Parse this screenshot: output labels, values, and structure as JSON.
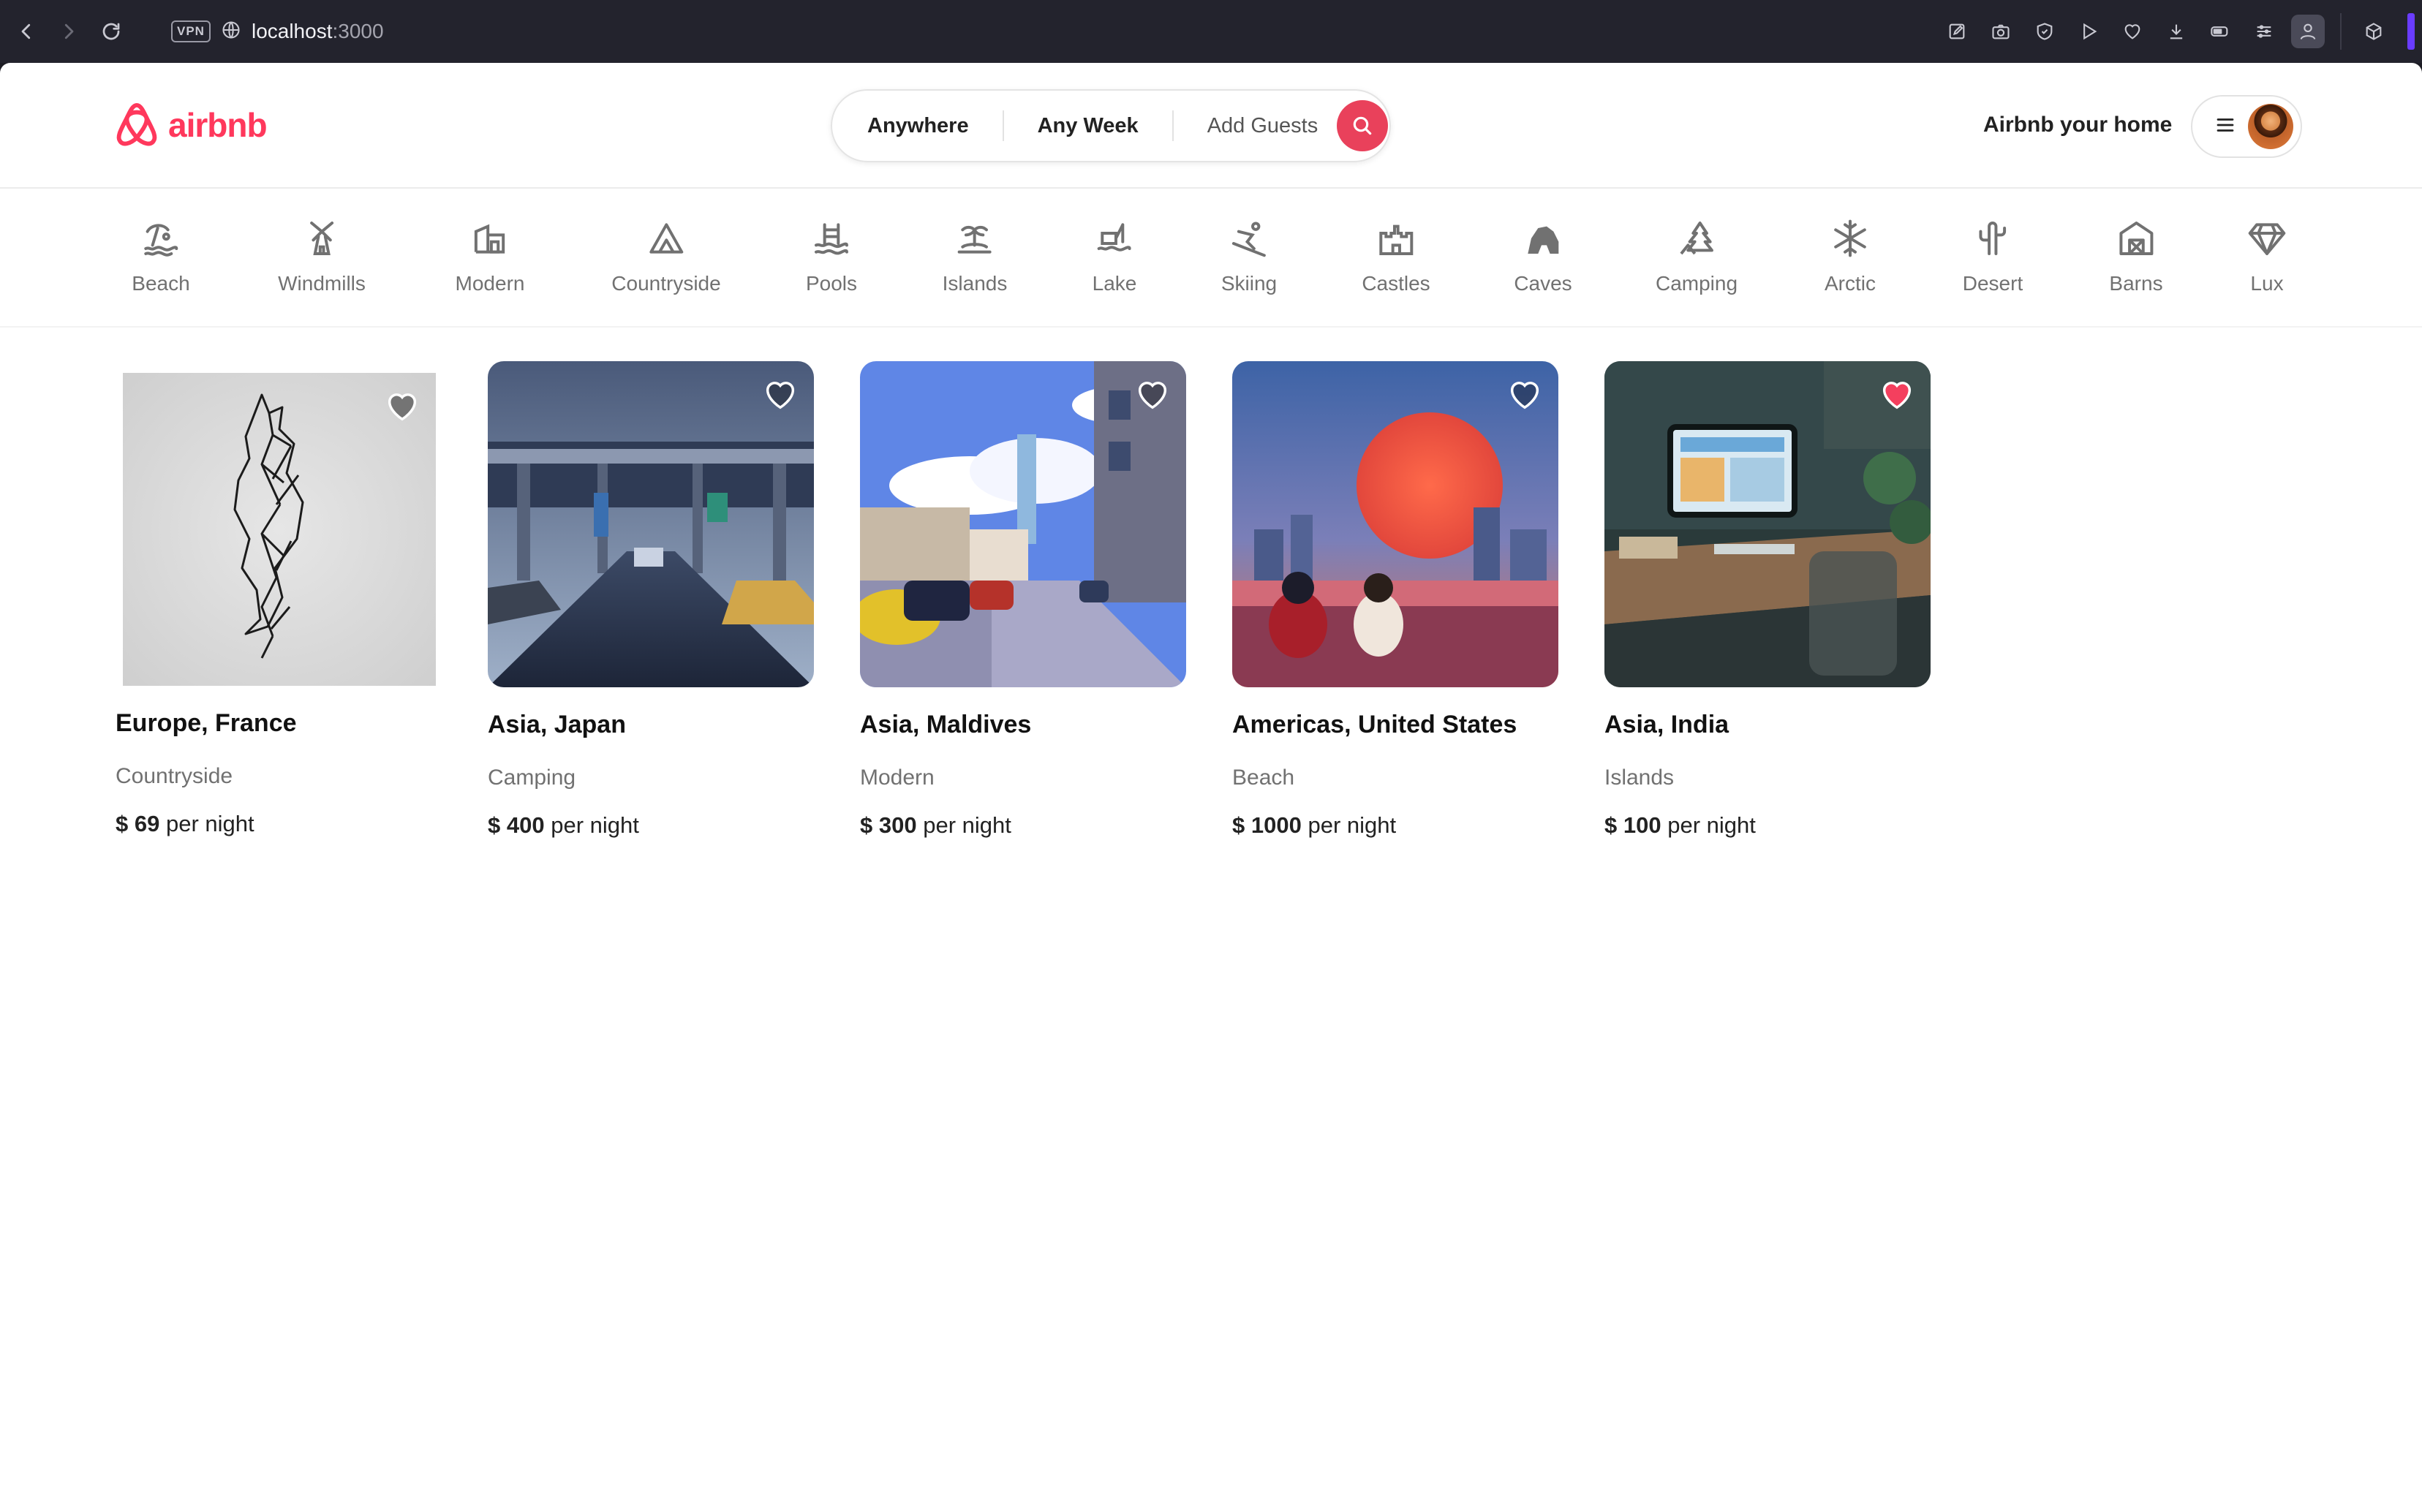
{
  "browser": {
    "url_host": "localhost",
    "url_port": ":3000",
    "vpn_label": "VPN"
  },
  "header": {
    "logo_text": "airbnb",
    "search": {
      "where": "Anywhere",
      "when": "Any Week",
      "guests": "Add Guests"
    },
    "host_link": "Airbnb your home"
  },
  "categories": [
    {
      "label": "Beach",
      "icon": "beach-icon"
    },
    {
      "label": "Windmills",
      "icon": "windmill-icon"
    },
    {
      "label": "Modern",
      "icon": "modern-home-icon"
    },
    {
      "label": "Countryside",
      "icon": "mountain-icon"
    },
    {
      "label": "Pools",
      "icon": "pool-icon"
    },
    {
      "label": "Islands",
      "icon": "island-icon"
    },
    {
      "label": "Lake",
      "icon": "lake-icon"
    },
    {
      "label": "Skiing",
      "icon": "skiing-icon"
    },
    {
      "label": "Castles",
      "icon": "castle-icon"
    },
    {
      "label": "Caves",
      "icon": "cave-icon"
    },
    {
      "label": "Camping",
      "icon": "camping-icon"
    },
    {
      "label": "Arctic",
      "icon": "snowflake-icon"
    },
    {
      "label": "Desert",
      "icon": "cactus-icon"
    },
    {
      "label": "Barns",
      "icon": "barn-icon"
    },
    {
      "label": "Lux",
      "icon": "diamond-icon"
    }
  ],
  "listings": [
    {
      "title": "Europe, France",
      "category": "Countryside",
      "currency": "$",
      "price": "69",
      "per": "per night",
      "favorited": false
    },
    {
      "title": "Asia, Japan",
      "category": "Camping",
      "currency": "$",
      "price": "400",
      "per": "per night",
      "favorited": false
    },
    {
      "title": "Asia, Maldives",
      "category": "Modern",
      "currency": "$",
      "price": "300",
      "per": "per night",
      "favorited": false
    },
    {
      "title": "Americas, United States",
      "category": "Beach",
      "currency": "$",
      "price": "1000",
      "per": "per night",
      "favorited": false
    },
    {
      "title": "Asia, India",
      "category": "Islands",
      "currency": "$",
      "price": "100",
      "per": "per night",
      "favorited": true
    }
  ],
  "colors": {
    "brand": "#ff385c",
    "search_button": "#e9415b",
    "heart_active": "#f43f5e"
  }
}
